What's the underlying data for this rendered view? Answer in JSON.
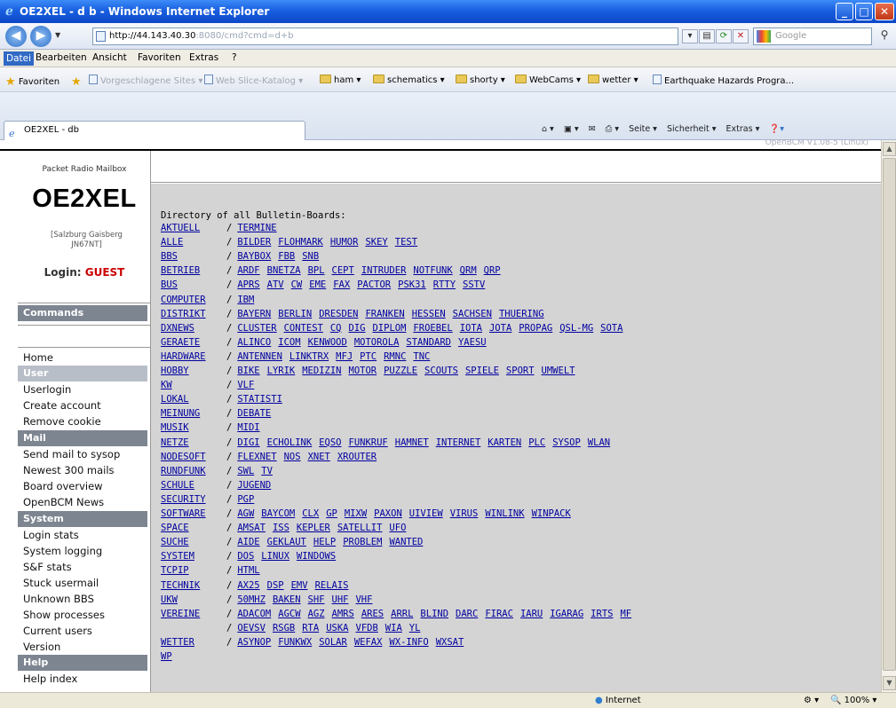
{
  "window": {
    "title": "OE2XEL - d b - Windows Internet Explorer"
  },
  "address": {
    "url_host": "http://44.143.40.30",
    "url_rest": ":8080/cmd?cmd=d+b",
    "search_placeholder": "Google"
  },
  "menu": {
    "items": [
      "Datei",
      "Bearbeiten",
      "Ansicht",
      "Favoriten",
      "Extras",
      "?"
    ]
  },
  "favorites": {
    "label": "Favoriten",
    "items": [
      "Vorgeschlagene Sites ▾",
      "Web Slice-Katalog ▾",
      "ham ▾",
      "schematics ▾",
      "shorty ▾",
      "WebCams ▾",
      "wetter ▾",
      "Earthquake Hazards Progra..."
    ]
  },
  "tab": {
    "label": "OE2XEL - db"
  },
  "commandbar": {
    "items": [
      "Seite ▾",
      "Sicherheit ▾",
      "Extras ▾"
    ]
  },
  "page": {
    "version_text": "OpenBCM V1.08-5 (Linux)"
  },
  "sidebar": {
    "subtitle": "Packet Radio Mailbox",
    "callsign": "OE2XEL",
    "location": "[Salzburg Gaisberg JN67NT]",
    "login_label": "Login:",
    "login_user": "GUEST",
    "sections": {
      "commands": "Commands",
      "user": "User",
      "mail": "Mail",
      "system": "System",
      "help": "Help"
    },
    "home": "Home",
    "user_items": [
      "Userlogin",
      "Create account",
      "Remove cookie"
    ],
    "mail_items": [
      "Send mail to sysop",
      "Newest 300 mails",
      "Board overview",
      "OpenBCM News"
    ],
    "system_items": [
      "Login stats",
      "System logging",
      "S&F stats",
      "Stuck usermail",
      "Unknown BBS",
      "Show processes",
      "Current users",
      "Version"
    ],
    "help_items": [
      "Help index"
    ]
  },
  "directory": {
    "heading": "Directory of all Bulletin-Boards:",
    "boards": [
      {
        "cat": "AKTUELL",
        "subs": [
          "TERMINE"
        ]
      },
      {
        "cat": "ALLE",
        "subs": [
          "BILDER",
          "FLOHMARK",
          "HUMOR",
          "SKEY",
          "TEST"
        ]
      },
      {
        "cat": "BBS",
        "subs": [
          "BAYBOX",
          "FBB",
          "SNB"
        ]
      },
      {
        "cat": "BETRIEB",
        "subs": [
          "ARDF",
          "BNETZA",
          "BPL",
          "CEPT",
          "INTRUDER",
          "NOTFUNK",
          "QRM",
          "QRP"
        ]
      },
      {
        "cat": "BUS",
        "subs": [
          "APRS",
          "ATV",
          "CW",
          "EME",
          "FAX",
          "PACTOR",
          "PSK31",
          "RTTY",
          "SSTV"
        ]
      },
      {
        "cat": "COMPUTER",
        "subs": [
          "IBM"
        ]
      },
      {
        "cat": "DISTRIKT",
        "subs": [
          "BAYERN",
          "BERLIN",
          "DRESDEN",
          "FRANKEN",
          "HESSEN",
          "SACHSEN",
          "THUERING"
        ]
      },
      {
        "cat": "DXNEWS",
        "subs": [
          "CLUSTER",
          "CONTEST",
          "CQ",
          "DIG",
          "DIPLOM",
          "FROEBEL",
          "IOTA",
          "JOTA",
          "PROPAG",
          "QSL-MG",
          "SOTA"
        ]
      },
      {
        "cat": "GERAETE",
        "subs": [
          "ALINCO",
          "ICOM",
          "KENWOOD",
          "MOTOROLA",
          "STANDARD",
          "YAESU"
        ]
      },
      {
        "cat": "HARDWARE",
        "subs": [
          "ANTENNEN",
          "LINKTRX",
          "MFJ",
          "PTC",
          "RMNC",
          "TNC"
        ]
      },
      {
        "cat": "HOBBY",
        "subs": [
          "BIKE",
          "LYRIK",
          "MEDIZIN",
          "MOTOR",
          "PUZZLE",
          "SCOUTS",
          "SPIELE",
          "SPORT",
          "UMWELT"
        ]
      },
      {
        "cat": "KW",
        "subs": [
          "VLF"
        ]
      },
      {
        "cat": "LOKAL",
        "subs": [
          "STATISTI"
        ]
      },
      {
        "cat": "MEINUNG",
        "subs": [
          "DEBATE"
        ]
      },
      {
        "cat": "MUSIK",
        "subs": [
          "MIDI"
        ]
      },
      {
        "cat": "NETZE",
        "subs": [
          "DIGI",
          "ECHOLINK",
          "EQSO",
          "FUNKRUF",
          "HAMNET",
          "INTERNET",
          "KARTEN",
          "PLC",
          "SYSOP",
          "WLAN"
        ]
      },
      {
        "cat": "NODESOFT",
        "subs": [
          "FLEXNET",
          "NOS",
          "XNET",
          "XROUTER"
        ]
      },
      {
        "cat": "RUNDFUNK",
        "subs": [
          "SWL",
          "TV"
        ]
      },
      {
        "cat": "SCHULE",
        "subs": [
          "JUGEND"
        ]
      },
      {
        "cat": "SECURITY",
        "subs": [
          "PGP"
        ]
      },
      {
        "cat": "SOFTWARE",
        "subs": [
          "AGW",
          "BAYCOM",
          "CLX",
          "GP",
          "MIXW",
          "PAXON",
          "UIVIEW",
          "VIRUS",
          "WINLINK",
          "WINPACK"
        ]
      },
      {
        "cat": "SPACE",
        "subs": [
          "AMSAT",
          "ISS",
          "KEPLER",
          "SATELLIT",
          "UFO"
        ]
      },
      {
        "cat": "SUCHE",
        "subs": [
          "AIDE",
          "GEKLAUT",
          "HELP",
          "PROBLEM",
          "WANTED"
        ]
      },
      {
        "cat": "SYSTEM",
        "subs": [
          "DOS",
          "LINUX",
          "WINDOWS"
        ]
      },
      {
        "cat": "TCPIP",
        "subs": [
          "HTML"
        ]
      },
      {
        "cat": "TECHNIK",
        "subs": [
          "AX25",
          "DSP",
          "EMV",
          "RELAIS"
        ]
      },
      {
        "cat": "UKW",
        "subs": [
          "50MHZ",
          "BAKEN",
          "SHF",
          "UHF",
          "VHF"
        ]
      },
      {
        "cat": "VEREINE",
        "subs": [
          "ADACOM",
          "AGCW",
          "AGZ",
          "AMRS",
          "ARES",
          "ARRL",
          "BLIND",
          "DARC",
          "FIRAC",
          "IARU",
          "IGARAG",
          "IRTS",
          "MF"
        ]
      },
      {
        "cat": "",
        "subs": [
          "OEVSV",
          "RSGB",
          "RTA",
          "USKA",
          "VFDB",
          "WIA",
          "YL"
        ]
      },
      {
        "cat": "WETTER",
        "subs": [
          "ASYNOP",
          "FUNKWX",
          "SOLAR",
          "WEFAX",
          "WX-INFO",
          "WXSAT"
        ]
      },
      {
        "cat": "WP",
        "subs": []
      }
    ]
  },
  "status": {
    "zone": "Internet",
    "zoom": "100%"
  },
  "colors": {
    "titlebar": "#0a48c8",
    "link": "#0000a0",
    "section_bar": "#7d8591",
    "login_user": "#cc0000",
    "board_bg": "#d4d4d4"
  }
}
